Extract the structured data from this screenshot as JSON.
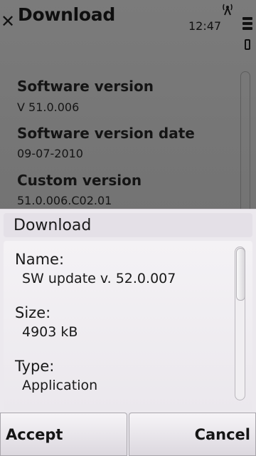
{
  "background": {
    "title": "Download",
    "clock": "12:47",
    "items": [
      {
        "label": "Software version",
        "value": "V 51.0.006"
      },
      {
        "label": "Software version date",
        "value": "09-07-2010"
      },
      {
        "label": "Custom version",
        "value": "51.0.006.C02.01"
      }
    ]
  },
  "dialog": {
    "title": "Download",
    "fields": [
      {
        "label": "Name:",
        "value": "SW update v. 52.0.007"
      },
      {
        "label": "Size:",
        "value": "4903 kB"
      },
      {
        "label": "Type:",
        "value": "Application"
      }
    ]
  },
  "softkeys": {
    "left": "Accept",
    "right": "Cancel"
  },
  "icons": {
    "close": "close-icon",
    "signal": "signal-antenna-icon",
    "menu": "options-menu-icon",
    "battery": "battery-icon"
  }
}
